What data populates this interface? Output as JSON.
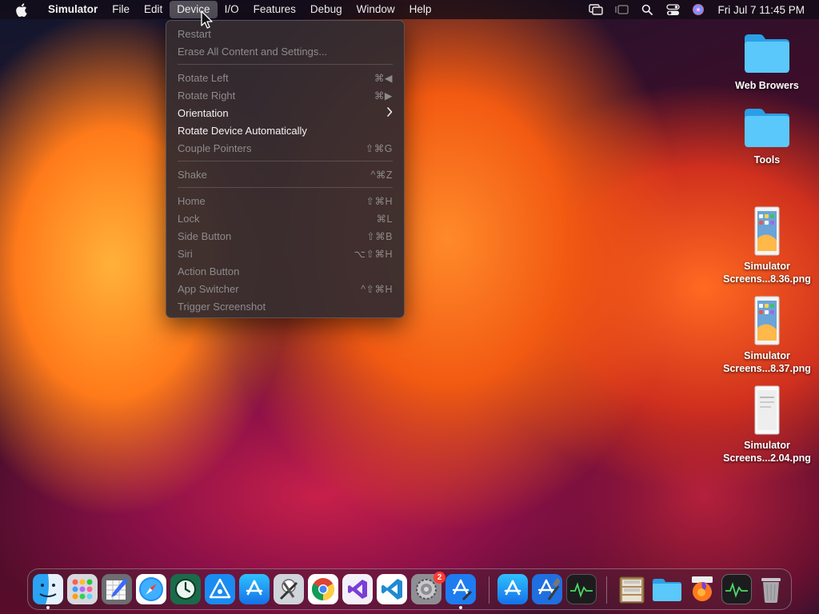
{
  "menubar": {
    "app_name": "Simulator",
    "menus": [
      "File",
      "Edit",
      "Device",
      "I/O",
      "Features",
      "Debug",
      "Window",
      "Help"
    ],
    "active_menu": "Device",
    "clock": "Fri Jul 7  11:45 PM"
  },
  "device_menu": {
    "items": [
      {
        "label": "Restart",
        "shortcut": ""
      },
      {
        "label": "Erase All Content and Settings...",
        "shortcut": ""
      },
      {
        "label": "Rotate Left",
        "shortcut": "⌘◀"
      },
      {
        "label": "Rotate Right",
        "shortcut": "⌘▶"
      },
      {
        "label": "Orientation",
        "shortcut": ""
      },
      {
        "label": "Rotate Device Automatically",
        "shortcut": ""
      },
      {
        "label": "Couple Pointers",
        "shortcut": "⇧⌘G"
      },
      {
        "label": "Shake",
        "shortcut": "^⌘Z"
      },
      {
        "label": "Home",
        "shortcut": "⇧⌘H"
      },
      {
        "label": "Lock",
        "shortcut": "⌘L"
      },
      {
        "label": "Side Button",
        "shortcut": "⇧⌘B"
      },
      {
        "label": "Siri",
        "shortcut": "⌥⇧⌘H"
      },
      {
        "label": "Action Button",
        "shortcut": ""
      },
      {
        "label": "App Switcher",
        "shortcut": "^⇧⌘H"
      },
      {
        "label": "Trigger Screenshot",
        "shortcut": ""
      }
    ]
  },
  "desktop": {
    "icons": [
      {
        "label": "Web Browers"
      },
      {
        "label": "Tools"
      },
      {
        "line1": "Simulator",
        "line2": "Screens...8.36.png"
      },
      {
        "line1": "Simulator",
        "line2": "Screens...8.37.png"
      },
      {
        "line1": "Simulator",
        "line2": "Screens...2.04.png"
      }
    ]
  },
  "dock": {
    "settings_badge": "2"
  },
  "colors": {
    "menu_bg": "#342c30",
    "folder_blue": "#5ac8fa",
    "badge_red": "#ff3b30"
  }
}
